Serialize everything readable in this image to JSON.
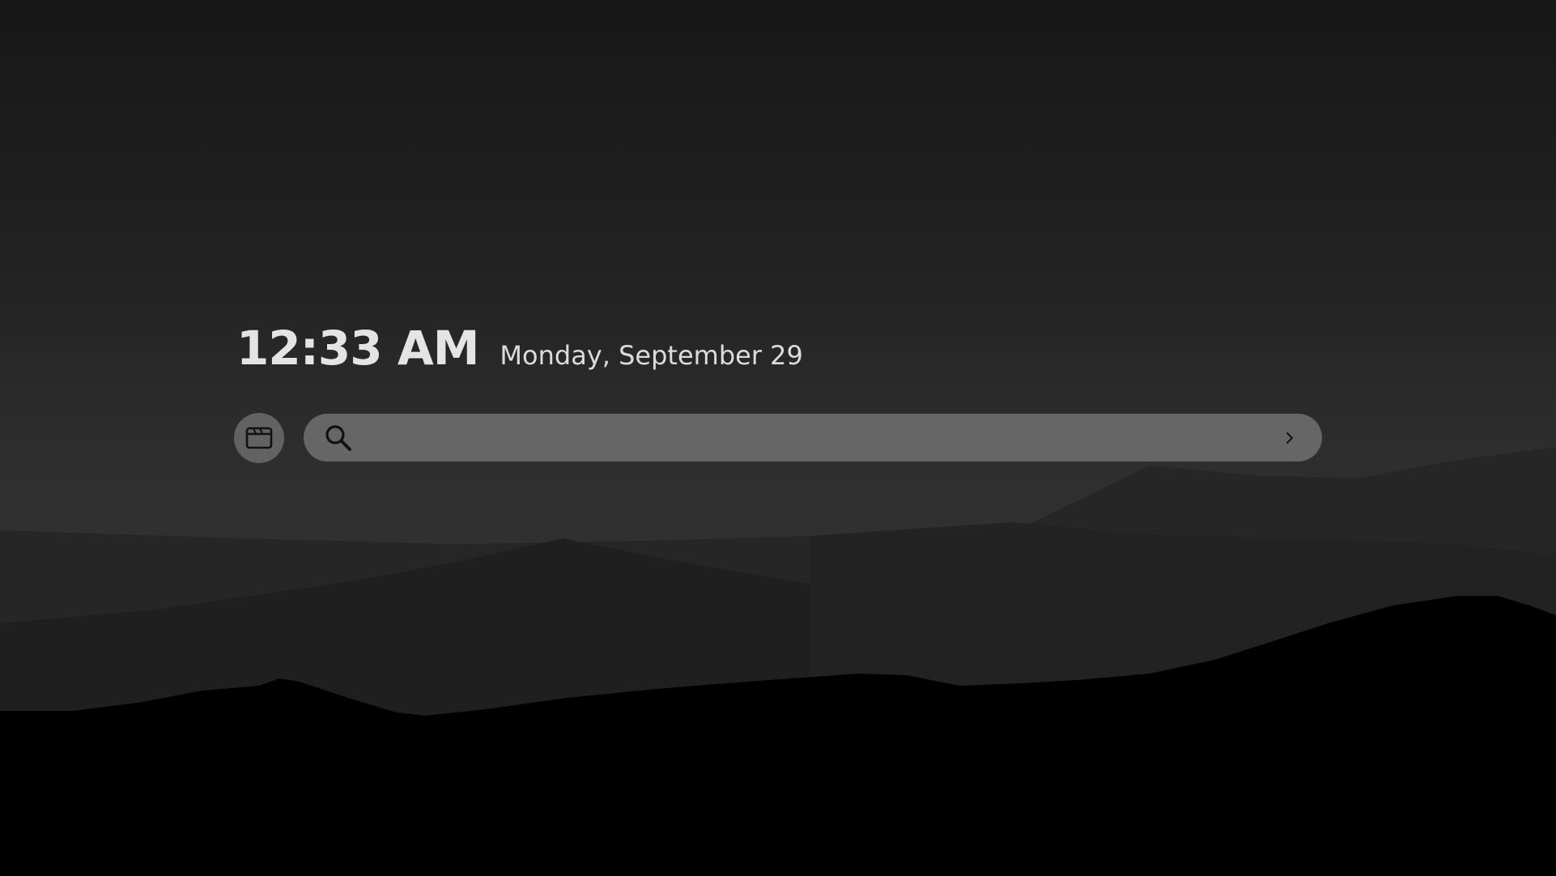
{
  "clock": {
    "time": "12:33 AM",
    "date": "Monday, September 29"
  },
  "search": {
    "value": "",
    "placeholder": ""
  },
  "icons": {
    "tab_button": "browser-window-icon",
    "search": "search-icon",
    "submit": "chevron-right-icon"
  },
  "colors": {
    "background_top": "#171717",
    "background_mid": "#303030",
    "foreground_hills": "#000000",
    "search_bar": "#666666",
    "tab_button": "#626262",
    "clock_text": "#e4e4e4"
  }
}
